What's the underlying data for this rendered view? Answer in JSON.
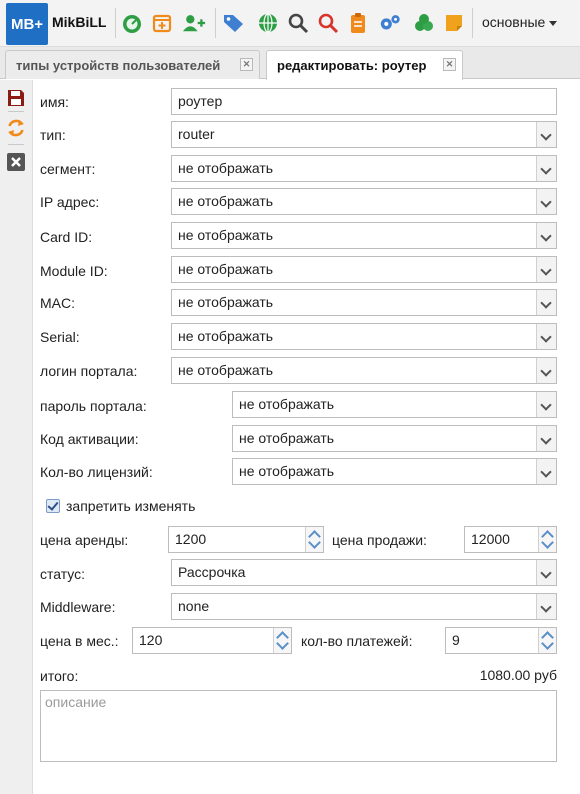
{
  "header": {
    "logo": "MB+",
    "brand": "MikBiLL",
    "menu_label": "основные",
    "icons": [
      "dashboard-icon",
      "calendar-add-icon",
      "add-user-icon",
      "tags-icon",
      "globe-icon",
      "search-icon",
      "search-red-icon",
      "clipboard-icon",
      "settings-icon",
      "money-icon",
      "note-icon"
    ],
    "colors": {
      "logo_bg": "#1f6fc5",
      "green": "#2e9e45",
      "orange": "#f08a1c",
      "blue": "#3f7fd1",
      "red": "#d9342b"
    }
  },
  "tabs": [
    {
      "label": "типы устройств пользователей",
      "active": false
    },
    {
      "label": "редактировать: роутер",
      "active": true
    }
  ],
  "side_tools": [
    "save-icon",
    "refresh-icon",
    "close-icon"
  ],
  "form": {
    "name_label": "имя:",
    "name_value": "роутер",
    "type_label": "тип:",
    "type_value": "router",
    "segment_label": "сегмент:",
    "segment_value": "не отображать",
    "ip_label": "IP адрес:",
    "ip_value": "не отображать",
    "card_label": "Card ID:",
    "card_value": "не отображать",
    "module_label": "Module ID:",
    "module_value": "не отображать",
    "mac_label": "MAC:",
    "mac_value": "не отображать",
    "serial_label": "Serial:",
    "serial_value": "не отображать",
    "portal_login_label": "логин портала:",
    "portal_login_value": "не отображать",
    "portal_password_label": "пароль портала:",
    "portal_password_value": "не отображать",
    "activation_label": "Код активации:",
    "activation_value": "не отображать",
    "licenses_label": "Кол-во лицензий:",
    "licenses_value": "не отображать",
    "forbid_label": "запретить изменять",
    "forbid_checked": true,
    "rent_label": "цена аренды:",
    "rent_value": "1200",
    "sale_label": "цена продажи:",
    "sale_value": "12000",
    "status_label": "статус:",
    "status_value": "Рассрочка",
    "middleware_label": "Middleware:",
    "middleware_value": "none",
    "monthly_label": "цена в мес.:",
    "monthly_value": "120",
    "payments_label": "кол-во платежей:",
    "payments_value": "9",
    "total_label": "итого:",
    "total_value": "1080.00 руб",
    "description_placeholder": "описание"
  }
}
